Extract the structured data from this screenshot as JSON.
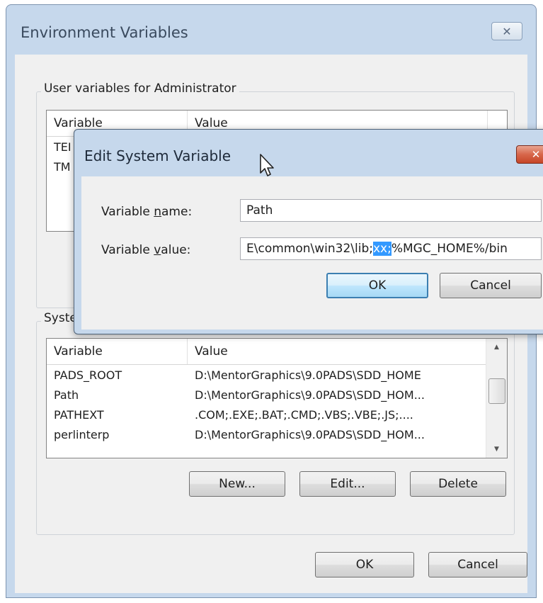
{
  "window": {
    "title": "Environment Variables",
    "close_glyph": "✕"
  },
  "user_group": {
    "label": "User variables for Administrator",
    "col_variable": "Variable",
    "col_value": "Value",
    "rows": [
      {
        "name": "TEI"
      },
      {
        "name": "TM"
      }
    ]
  },
  "system_group": {
    "label": "Syste",
    "col_variable": "Variable",
    "col_value": "Value",
    "rows": [
      {
        "name": "PADS_ROOT",
        "value": "D:\\MentorGraphics\\9.0PADS\\SDD_HOME"
      },
      {
        "name": "Path",
        "value": "D:\\MentorGraphics\\9.0PADS\\SDD_HOM..."
      },
      {
        "name": "PATHEXT",
        "value": ".COM;.EXE;.BAT;.CMD;.VBS;.VBE;.JS;...."
      },
      {
        "name": "perlinterp",
        "value": "D:\\MentorGraphics\\9.0PADS\\SDD_HOM..."
      }
    ],
    "buttons": {
      "new": "New...",
      "edit": "Edit...",
      "delete": "Delete"
    }
  },
  "footer": {
    "ok": "OK",
    "cancel": "Cancel"
  },
  "edit_dialog": {
    "title": "Edit System Variable",
    "close_glyph": "✕",
    "name_label_pre": "Variable ",
    "name_label_key": "n",
    "name_label_post": "ame:",
    "name_value": "Path",
    "value_label_pre": "Variable ",
    "value_label_key": "v",
    "value_label_post": "alue:",
    "value_before": "E\\common\\win32\\lib;",
    "value_selected": "xx;",
    "value_after": "%MGC_HOME%/bin",
    "ok": "OK",
    "cancel": "Cancel"
  },
  "colors": {
    "accent": "#3399ff",
    "title_bar": "#c6d8ec",
    "close_red": "#d7664a"
  }
}
